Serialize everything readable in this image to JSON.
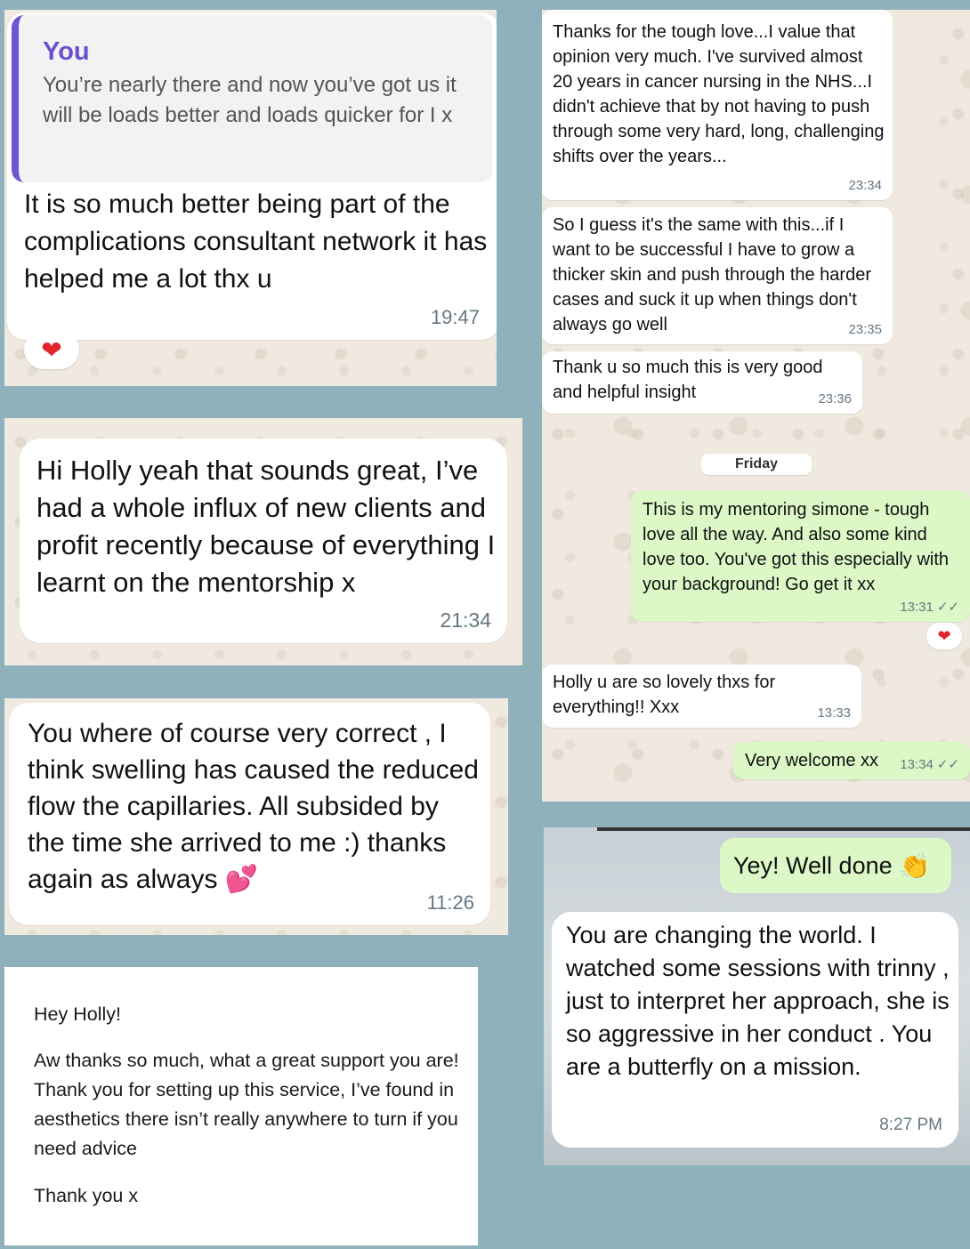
{
  "panelA": {
    "quote_author": "You",
    "quote_text": "You’re nearly there and now you’ve got us it will be loads better and loads quicker for I x",
    "message": "It is so much better being part of the complications consultant network it has helped me a lot thx u",
    "time": "19:47",
    "reaction": "❤"
  },
  "panelB": {
    "message": "Hi Holly yeah that sounds great, I’ve had a whole influx of new clients and profit recently because of everything I learnt on the mentorship x",
    "time": "21:34"
  },
  "panelC": {
    "message": "You where of course very correct , I think swelling has caused the reduced flow the capillaries. All subsided by the time she arrived to me :) thanks again as always",
    "emoji": "💕",
    "time": "11:26"
  },
  "panelD": {
    "greeting": "Hey Holly!",
    "body": "Aw thanks so much, what a great support you are! Thank you for setting up this service, I’ve found in aesthetics there isn’t really anywhere to turn if you need advice",
    "signoff": "Thank you x"
  },
  "panelE": {
    "messages": [
      {
        "text": "Thanks for the tough love...I value that opinion very much. I've survived almost 20 years in cancer nursing in the NHS...I didn't achieve that by not having to push through some very hard, long, challenging shifts over the years...",
        "time": "23:34"
      },
      {
        "text": "So I guess it's the same with this...if I want to be successful I have to grow a thicker skin and push through the harder cases and suck it up when things don't always go well",
        "time": "23:35"
      },
      {
        "text": "Thank u so much this is very good and helpful insight",
        "time": "23:36"
      },
      {
        "text": "This is my mentoring simone - tough love all the way. And also some kind love too. You've got this especially with your background! Go get it xx",
        "time": "13:31",
        "ticks": "✓✓"
      },
      {
        "text": "Holly u are so lovely thxs for everything!! Xxx",
        "time": "13:33"
      },
      {
        "text": "Very welcome xx",
        "time": "13:34",
        "ticks": "✓✓"
      }
    ],
    "day_label": "Friday",
    "reaction": "❤"
  },
  "panelF": {
    "reply": "Yey! Well done",
    "clap": "👏",
    "message": "You are changing the world. I watched some sessions with trinny , just to interpret her approach, she is so aggressive  in her conduct . You are a butterfly on a mission.",
    "time": "8:27 PM"
  },
  "colors": {
    "page_bg": "#8fb1bb",
    "chat_bg": "#efe9df",
    "outgoing_bubble": "#dcf8c6",
    "quote_accent": "#6f54d3"
  }
}
